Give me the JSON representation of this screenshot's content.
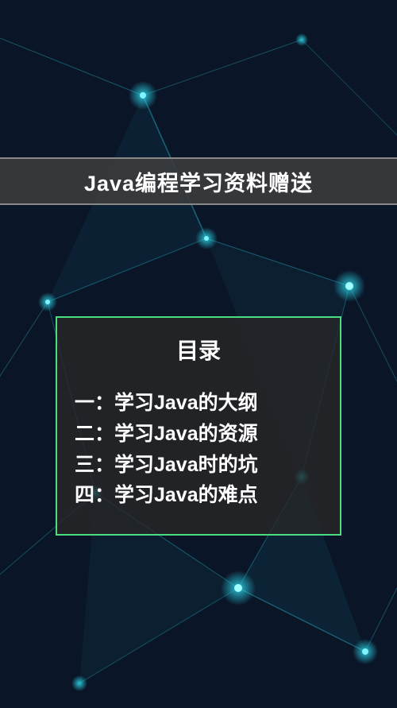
{
  "title": "Java编程学习资料赠送",
  "toc": {
    "heading": "目录",
    "items": [
      "一：学习Java的大纲",
      "二：学习Java的资源",
      "三：学习Java时的坑",
      "四：学习Java的难点"
    ]
  },
  "colors": {
    "bg": "#0a1628",
    "accent": "#4ade80",
    "node": "#2dd4e8"
  }
}
